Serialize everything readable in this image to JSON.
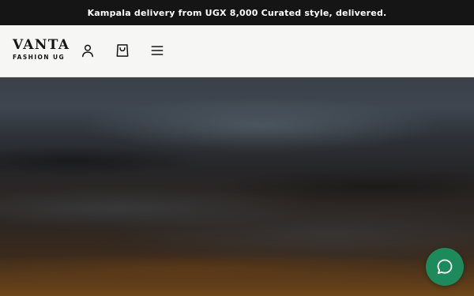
{
  "announcement": {
    "text": "Kampala delivery from UGX 8,000 Curated style, delivered."
  },
  "header": {
    "logo": {
      "name": "VANTA",
      "tagline": "FASHION UG"
    },
    "icons": {
      "account": "user-icon",
      "cart": "shopping-bag-icon",
      "menu": "hamburger-menu-icon"
    }
  },
  "chat": {
    "icon": "chat-bubble-icon",
    "color": "#1d8a5b"
  },
  "colors": {
    "announcement_bg": "#151515",
    "header_bg": "#f6f6f4",
    "text": "#151515"
  }
}
